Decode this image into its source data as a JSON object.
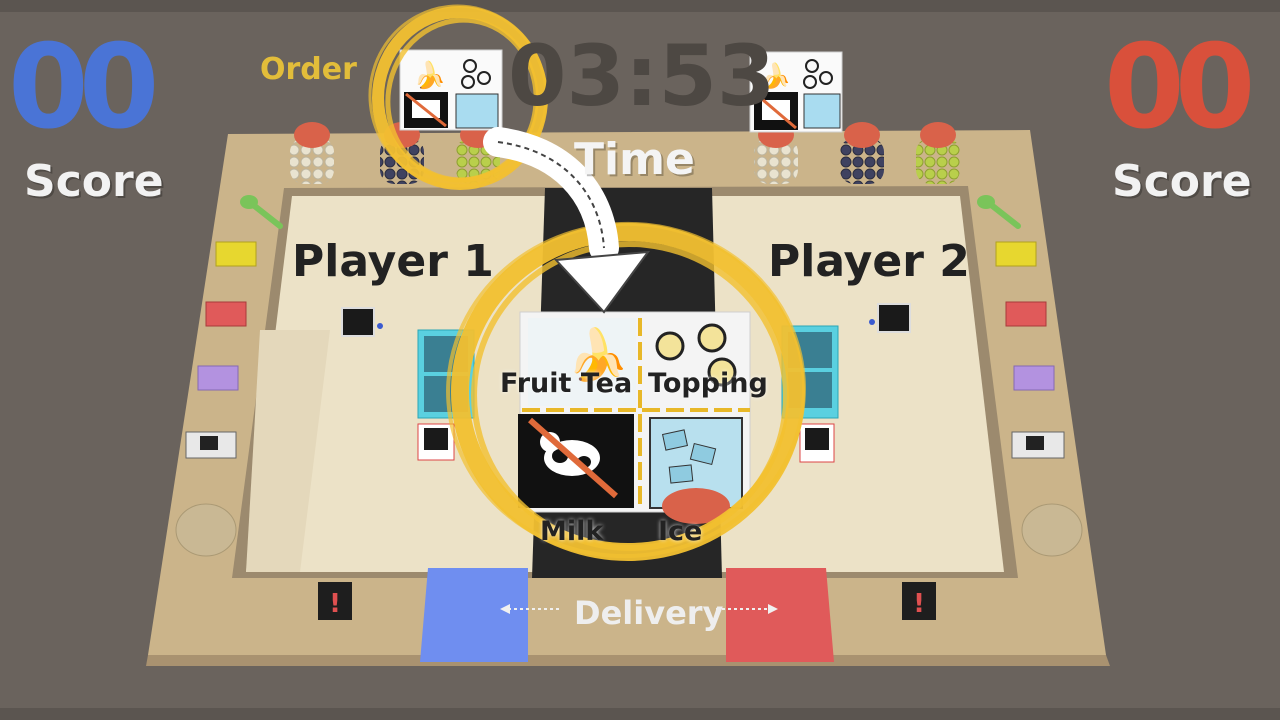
{
  "colors": {
    "background": "#6a635d",
    "player1": "#4a74d6",
    "player2": "#d9503b",
    "highlight": "#f2c030",
    "board": "#cdb78a",
    "floor": "#e8dcc0"
  },
  "hud": {
    "player1": {
      "score": "00",
      "score_label": "Score"
    },
    "player2": {
      "score": "00",
      "score_label": "Score"
    },
    "timer": "03:53",
    "time_label": "Time",
    "order_label": "Order"
  },
  "board": {
    "player1_label": "Player 1",
    "player2_label": "Player 2",
    "delivery_label": "Delivery"
  },
  "order_card": {
    "icons": [
      "banana-icon",
      "bubbles-icon",
      "no-milk-cow-icon",
      "ice-cubes-icon"
    ],
    "labels": {
      "fruit_tea": "Fruit Tea",
      "topping": "Topping",
      "milk": "Milk",
      "ice": "Ice"
    }
  }
}
